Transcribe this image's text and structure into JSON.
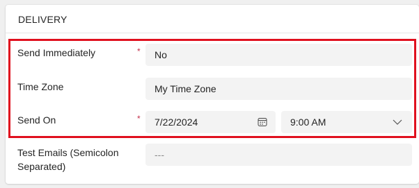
{
  "section": {
    "title": "DELIVERY"
  },
  "fields": {
    "send_immediately": {
      "label": "Send Immediately",
      "required_mark": "*",
      "value": "No"
    },
    "time_zone": {
      "label": "Time Zone",
      "value": "My Time Zone"
    },
    "send_on": {
      "label": "Send On",
      "required_mark": "*",
      "date": "7/22/2024",
      "time": "9:00 AM"
    },
    "test_emails": {
      "label_line1": "Test Emails (Semicolon",
      "label_line2": "Separated)",
      "value": "---"
    }
  },
  "colors": {
    "highlight": "#e0101e",
    "required": "#c4314b",
    "field_bg": "#f3f3f3"
  },
  "icons": {
    "date": "calendar-icon",
    "time": "chevron-down-icon"
  }
}
